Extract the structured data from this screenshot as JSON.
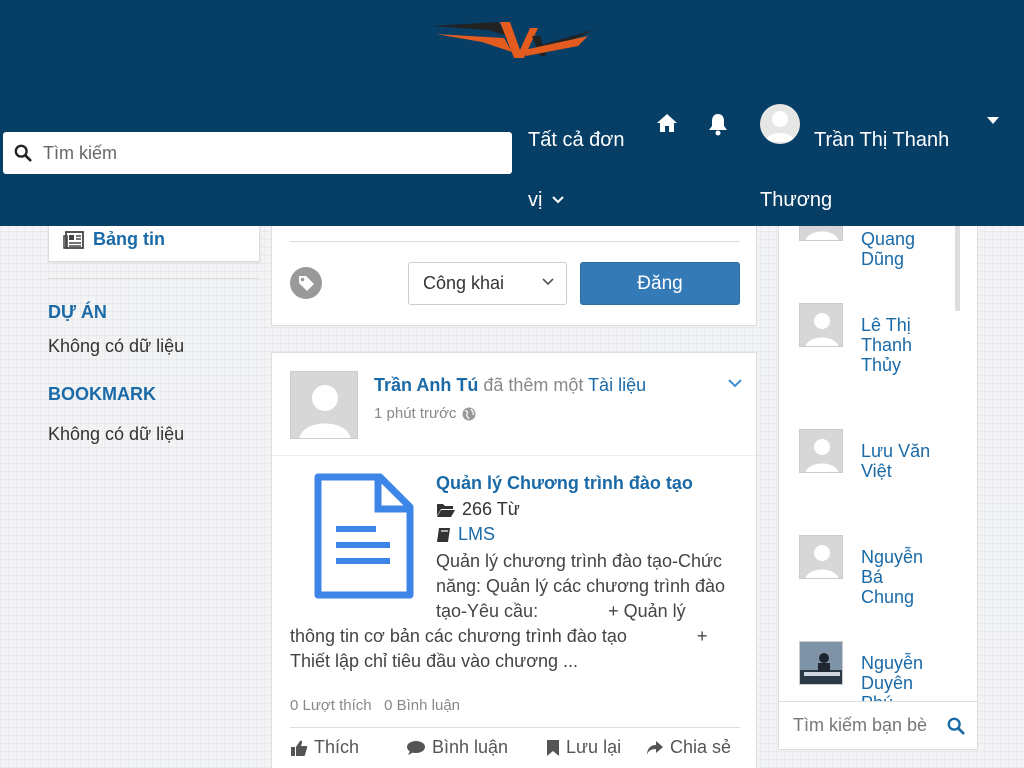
{
  "header": {
    "search_placeholder": "Tìm kiếm",
    "units_label_line1": "Tất cả đơn",
    "units_label_line2": "vị",
    "user_name_line1": "Trần Thị Thanh",
    "user_name_line2": "Thương",
    "bg_color": "#063e66"
  },
  "sidebar": {
    "newsfeed_label": "Bảng tin",
    "sections": [
      {
        "title": "DỰ ÁN",
        "empty_text": "Không có dữ liệu"
      },
      {
        "title": "BOOKMARK",
        "empty_text": "Không có dữ liệu"
      }
    ]
  },
  "composer": {
    "privacy_value": "Công khai",
    "post_button_label": "Đăng"
  },
  "post": {
    "author": "Trần Anh Tú",
    "action_text": " đã thêm một ",
    "object_link": "Tài liệu",
    "time_ago": "1 phút trước",
    "document": {
      "title": "Quản lý Chương trình đào tạo",
      "word_count": "266 Từ",
      "category": "LMS",
      "description_line1": "Quản lý chương trình đào tạo-Chức",
      "description_line2": "năng: Quản lý các chương trình đào",
      "description_line3": "tạo-Yêu cầu:              + Quản lý",
      "description_line4": "thông tin cơ bản các chương trình đào tạo              +",
      "description_line5": "Thiết lập chỉ tiêu đầu vào chương ..."
    },
    "likes_text": "0 Lượt thích",
    "comments_text": "0 Bình luận",
    "actions": {
      "like": "Thích",
      "comment": "Bình luận",
      "save": "Lưu lại",
      "share": "Chia sẻ"
    }
  },
  "friends": {
    "items": [
      {
        "name": "Quang Dũng"
      },
      {
        "name": "Lê Thị Thanh Thủy"
      },
      {
        "name": "Lưu Văn Việt"
      },
      {
        "name": "Nguyễn Bá Chung"
      },
      {
        "name": "Nguyễn Duyên Phú"
      }
    ],
    "search_placeholder": "Tìm kiếm bạn bè"
  }
}
